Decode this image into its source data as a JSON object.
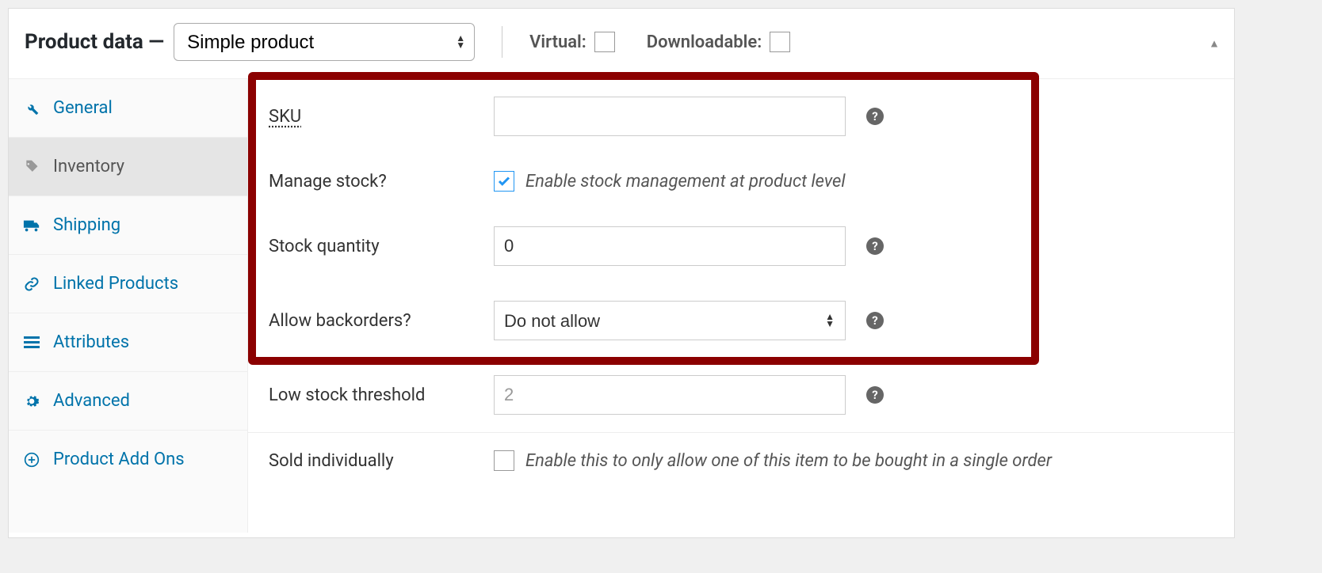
{
  "header": {
    "title_prefix": "Product data —",
    "product_type": "Simple product",
    "virtual_label": "Virtual:",
    "downloadable_label": "Downloadable:"
  },
  "tabs": [
    {
      "label": "General",
      "icon": "wrench"
    },
    {
      "label": "Inventory",
      "icon": "tag"
    },
    {
      "label": "Shipping",
      "icon": "truck"
    },
    {
      "label": "Linked Products",
      "icon": "link"
    },
    {
      "label": "Attributes",
      "icon": "list"
    },
    {
      "label": "Advanced",
      "icon": "gear"
    },
    {
      "label": "Product Add Ons",
      "icon": "plus"
    }
  ],
  "form": {
    "sku_label": "SKU",
    "sku_value": "",
    "manage_stock_label": "Manage stock?",
    "manage_stock_desc": "Enable stock management at product level",
    "stock_qty_label": "Stock quantity",
    "stock_qty_value": "0",
    "backorders_label": "Allow backorders?",
    "backorders_value": "Do not allow",
    "low_stock_label": "Low stock threshold",
    "low_stock_placeholder": "2",
    "sold_individually_label": "Sold individually",
    "sold_individually_desc": "Enable this to only allow one of this item to be bought in a single order"
  }
}
